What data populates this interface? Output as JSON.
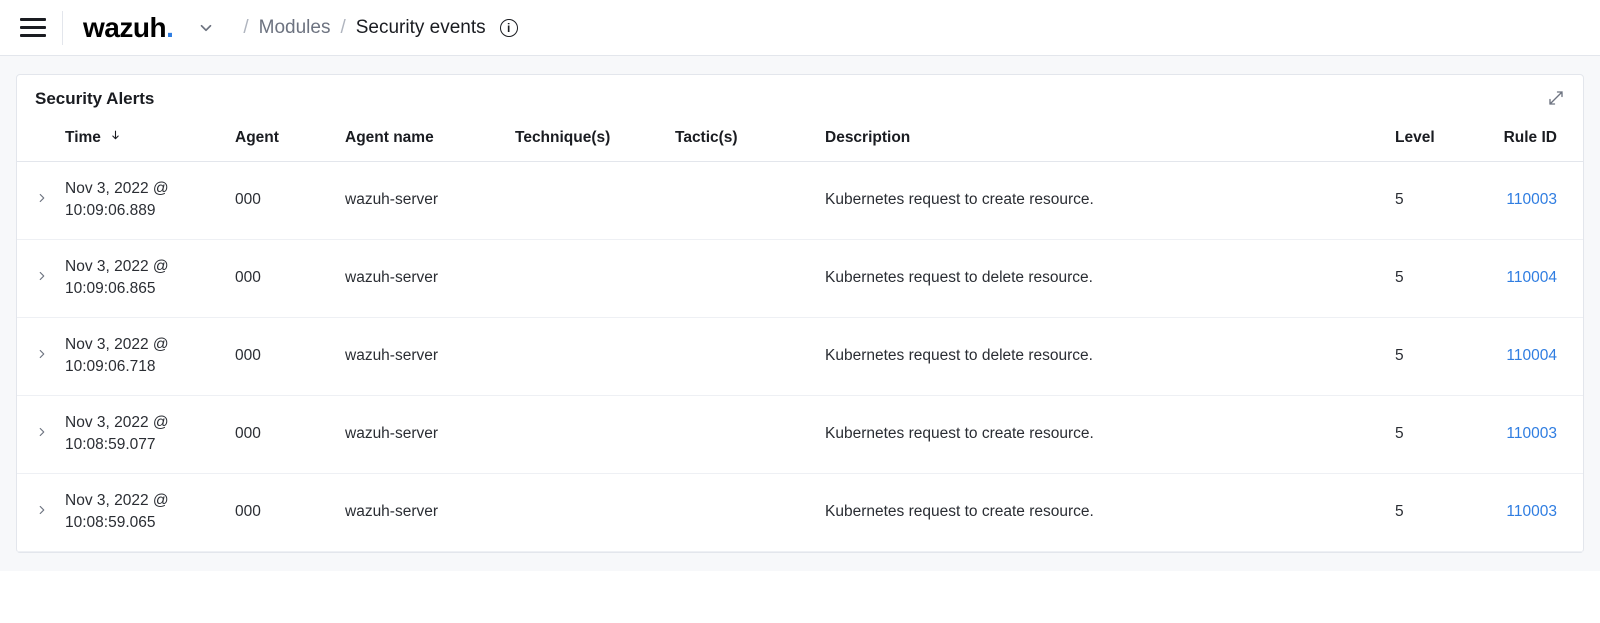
{
  "header": {
    "logo_text": "wazuh",
    "breadcrumb": {
      "parent": "Modules",
      "current": "Security events"
    }
  },
  "panel": {
    "title": "Security Alerts",
    "columns": {
      "time": "Time",
      "agent": "Agent",
      "agent_name": "Agent name",
      "technique": "Technique(s)",
      "tactic": "Tactic(s)",
      "description": "Description",
      "level": "Level",
      "rule_id": "Rule ID"
    },
    "rows": [
      {
        "time": "Nov 3, 2022 @ 10:09:06.889",
        "agent": "000",
        "agent_name": "wazuh-server",
        "technique": "",
        "tactic": "",
        "description": "Kubernetes request to create resource.",
        "level": "5",
        "rule_id": "110003"
      },
      {
        "time": "Nov 3, 2022 @ 10:09:06.865",
        "agent": "000",
        "agent_name": "wazuh-server",
        "technique": "",
        "tactic": "",
        "description": "Kubernetes request to delete resource.",
        "level": "5",
        "rule_id": "110004"
      },
      {
        "time": "Nov 3, 2022 @ 10:09:06.718",
        "agent": "000",
        "agent_name": "wazuh-server",
        "technique": "",
        "tactic": "",
        "description": "Kubernetes request to delete resource.",
        "level": "5",
        "rule_id": "110004"
      },
      {
        "time": "Nov 3, 2022 @ 10:08:59.077",
        "agent": "000",
        "agent_name": "wazuh-server",
        "technique": "",
        "tactic": "",
        "description": "Kubernetes request to create resource.",
        "level": "5",
        "rule_id": "110003"
      },
      {
        "time": "Nov 3, 2022 @ 10:08:59.065",
        "agent": "000",
        "agent_name": "wazuh-server",
        "technique": "",
        "tactic": "",
        "description": "Kubernetes request to create resource.",
        "level": "5",
        "rule_id": "110003"
      }
    ]
  }
}
